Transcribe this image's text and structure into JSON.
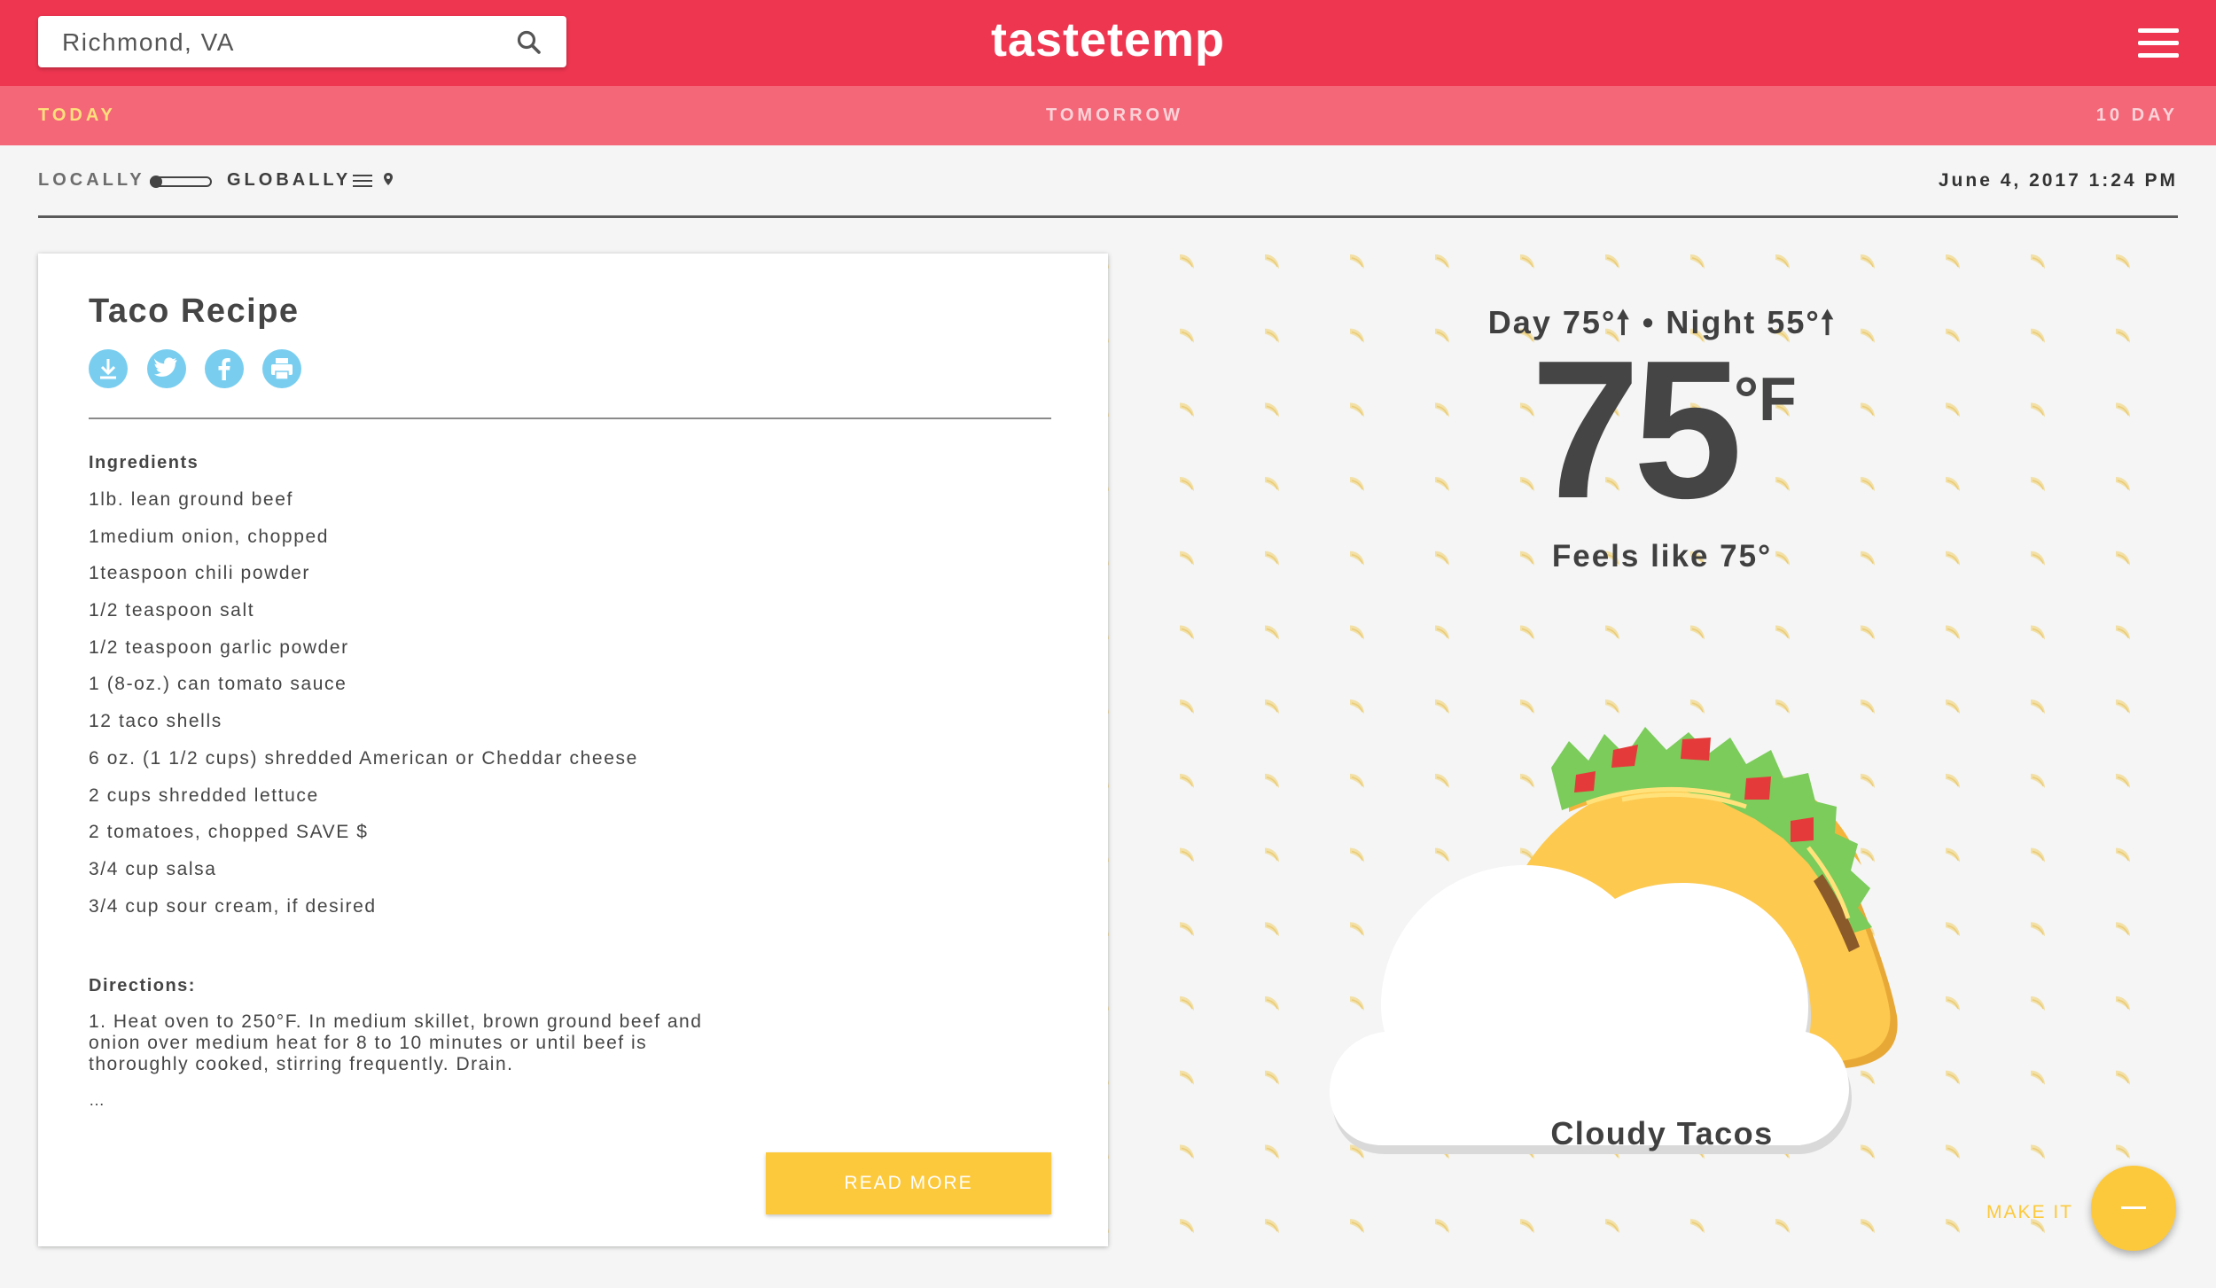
{
  "app": {
    "brand": "tastetemp"
  },
  "search": {
    "value": "Richmond, VA"
  },
  "tabs": [
    {
      "label": "TODAY",
      "active": true
    },
    {
      "label": "TOMORROW",
      "active": false
    },
    {
      "label": "10 DAY",
      "active": false
    }
  ],
  "scope_toggle": {
    "left_label": "LOCALLY",
    "right_label": "GLOBALLY",
    "selected": "LOCALLY"
  },
  "datetime": "June 4, 2017 1:24 PM",
  "recipe": {
    "title": "Taco Recipe",
    "share_buttons": [
      "download-icon",
      "twitter-icon",
      "facebook-icon",
      "print-icon"
    ],
    "ingredients_heading": "Ingredients",
    "ingredients": [
      "1lb. lean ground beef",
      "1medium onion, chopped",
      "1teaspoon chili powder",
      "1/2 teaspoon salt",
      "1/2 teaspoon garlic powder",
      "1 (8-oz.) can tomato sauce",
      "12 taco shells",
      "6 oz. (1 1/2 cups) shredded American or Cheddar cheese",
      "2 cups shredded lettuce",
      "2 tomatoes, chopped SAVE $",
      "3/4 cup salsa",
      "3/4 cup sour cream, if desired"
    ],
    "directions_heading": "Directions:",
    "directions_text": "1. Heat oven to 250°F. In medium skillet, brown ground beef and onion over medium heat for 8 to 10 minutes or until beef is thoroughly cooked, stirring frequently. Drain.",
    "ellipsis": "…",
    "read_more_label": "READ MORE"
  },
  "weather": {
    "day_night": "Day 75°🠕 • Night 55°🠕",
    "temperature": "75",
    "unit": "°F",
    "feels_like": "Feels like 75°",
    "condition": "Cloudy Tacos",
    "make_it_label": "MAKE IT"
  },
  "colors": {
    "appbar": "#ef3651",
    "tabbar": "#f36779",
    "active_tab": "#ffe07a",
    "accent_yellow": "#fdc93c",
    "share_blue": "#79cef0"
  }
}
